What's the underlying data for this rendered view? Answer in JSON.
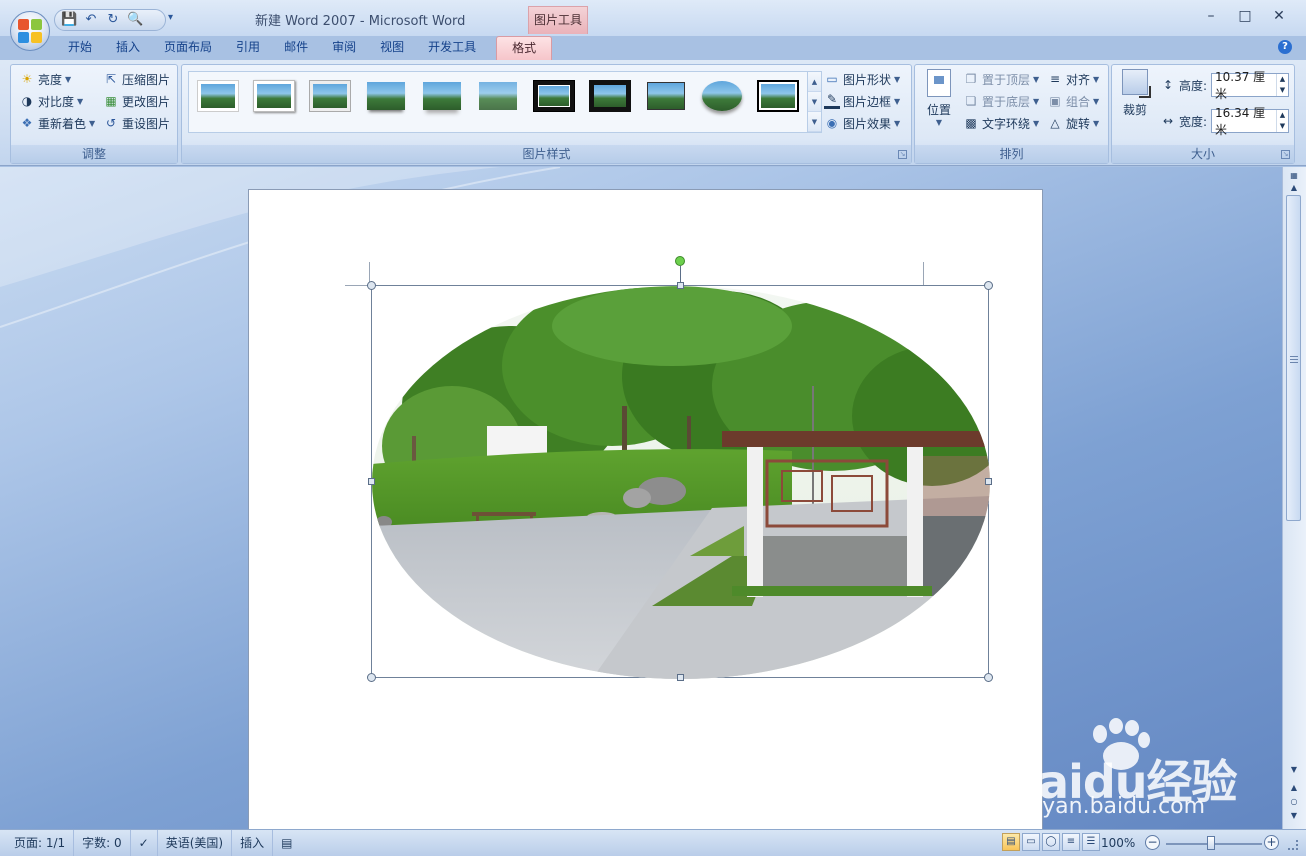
{
  "window": {
    "title": "新建 Word 2007 - Microsoft Word",
    "contextual_tab_group": "图片工具",
    "controls": [
      "–",
      "□",
      "✕"
    ]
  },
  "quick_access": {
    "save_icon": "save-icon",
    "undo_icon": "undo-icon",
    "redo_icon": "redo-icon",
    "print_preview_icon": "print-preview-icon"
  },
  "tabs": [
    "开始",
    "插入",
    "页面布局",
    "引用",
    "邮件",
    "审阅",
    "视图",
    "开发工具",
    "格式"
  ],
  "active_tab": "格式",
  "ribbon": {
    "adjust": {
      "label": "调整",
      "brightness": "亮度",
      "contrast": "对比度",
      "recolor": "重新着色",
      "compress": "压缩图片",
      "change": "更改图片",
      "reset": "重设图片"
    },
    "styles": {
      "label": "图片样式",
      "shape": "图片形状",
      "border": "图片边框",
      "effects": "图片效果"
    },
    "arrange": {
      "label": "排列",
      "position": "位置",
      "bring_front": "置于顶层",
      "send_back": "置于底层",
      "text_wrap": "文字环绕",
      "align": "对齐",
      "group": "组合",
      "rotate": "旋转"
    },
    "size": {
      "label": "大小",
      "crop": "裁剪",
      "height_label": "高度:",
      "height_value": "10.37 厘米",
      "width_label": "宽度:",
      "width_value": "16.34 厘米"
    }
  },
  "status": {
    "page": "页面: 1/1",
    "words": "字数: 0",
    "language": "英语(美国)",
    "mode": "插入",
    "zoom": "100%"
  },
  "watermark": {
    "brand": "Baidu经验",
    "url": "jingyan.baidu.com"
  },
  "colors": {
    "accent": "#15428b",
    "contextual_tab": "#f6c5ca",
    "ribbon_bg": "#dde8f6"
  }
}
